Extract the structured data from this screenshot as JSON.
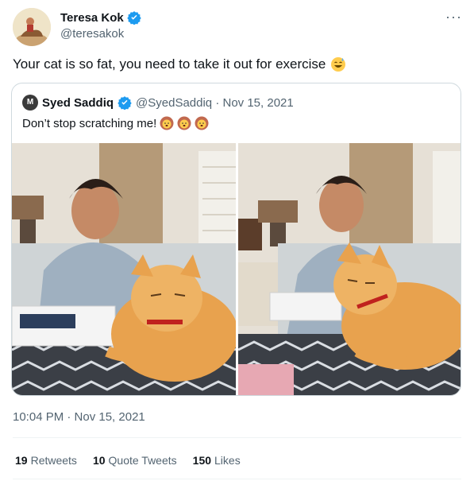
{
  "author": {
    "display_name": "Teresa Kok",
    "handle": "@teresakok",
    "verified": true
  },
  "tweet": {
    "text": "Your cat is so fat, you need to take it out for exercise",
    "emoji": "sweat-smile-emoji",
    "timestamp": "10:04 PM · Nov 15, 2021"
  },
  "quoted": {
    "avatar_initial": "M",
    "display_name": "Syed Saddiq",
    "meta": "@SyedSaddiq · Nov 15, 2021",
    "text": "Don’t stop scratching me!",
    "emojis": [
      "lion-emoji",
      "lion-emoji",
      "lion-emoji"
    ]
  },
  "stats": {
    "retweets_count": "19",
    "retweets_label": "Retweets",
    "quotes_count": "10",
    "quotes_label": "Quote Tweets",
    "likes_count": "150",
    "likes_label": "Likes"
  },
  "colors": {
    "verified_blue": "#1d9bf0",
    "secondary_text": "#536471",
    "border": "#cfd9de"
  }
}
